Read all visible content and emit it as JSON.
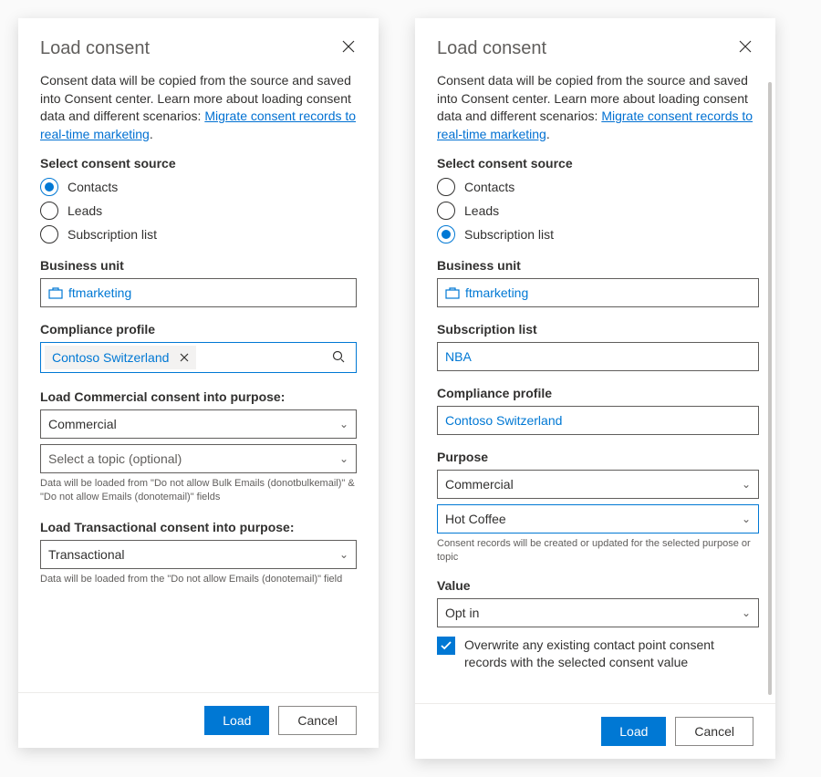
{
  "left": {
    "title": "Load consent",
    "intro1": "Consent data will be copied from the source and saved into Consent center. Learn more about loading consent data and different scenarios: ",
    "link": "Migrate consent records to real-time marketing",
    "sourceLabel": "Select consent source",
    "radios": {
      "contacts": "Contacts",
      "leads": "Leads",
      "sublist": "Subscription list"
    },
    "buLabel": "Business unit",
    "buValue": "ftmarketing",
    "cpLabel": "Compliance profile",
    "cpValue": "Contoso Switzerland",
    "commHeader": "Load Commercial consent into purpose:",
    "commValue": "Commercial",
    "topicPlaceholder": "Select a topic (optional)",
    "commHint": "Data will be loaded from \"Do not allow Bulk Emails (donotbulkemail)\" & \"Do not allow Emails (donotemail)\" fields",
    "tranHeader": "Load Transactional consent into purpose:",
    "tranValue": "Transactional",
    "tranHint": "Data will be loaded from the \"Do not allow Emails (donotemail)\" field",
    "load": "Load",
    "cancel": "Cancel"
  },
  "right": {
    "title": "Load consent",
    "intro1": "Consent data will be copied from the source and saved into Consent center. Learn more about loading consent data and different scenarios: ",
    "link": "Migrate consent records to real-time marketing",
    "sourceLabel": "Select consent source",
    "radios": {
      "contacts": "Contacts",
      "leads": "Leads",
      "sublist": "Subscription list"
    },
    "buLabel": "Business unit",
    "buValue": "ftmarketing",
    "slLabel": "Subscription list",
    "slValue": "NBA",
    "cpLabel": "Compliance profile",
    "cpValue": "Contoso Switzerland",
    "purposeLabel": "Purpose",
    "purposeValue": "Commercial",
    "topicValue": "Hot Coffee",
    "purposeHint": "Consent records will be created or updated for the selected purpose or topic",
    "valueLabel": "Value",
    "valueValue": "Opt in",
    "overwrite": "Overwrite any existing contact point consent records with the selected consent value",
    "load": "Load",
    "cancel": "Cancel"
  }
}
